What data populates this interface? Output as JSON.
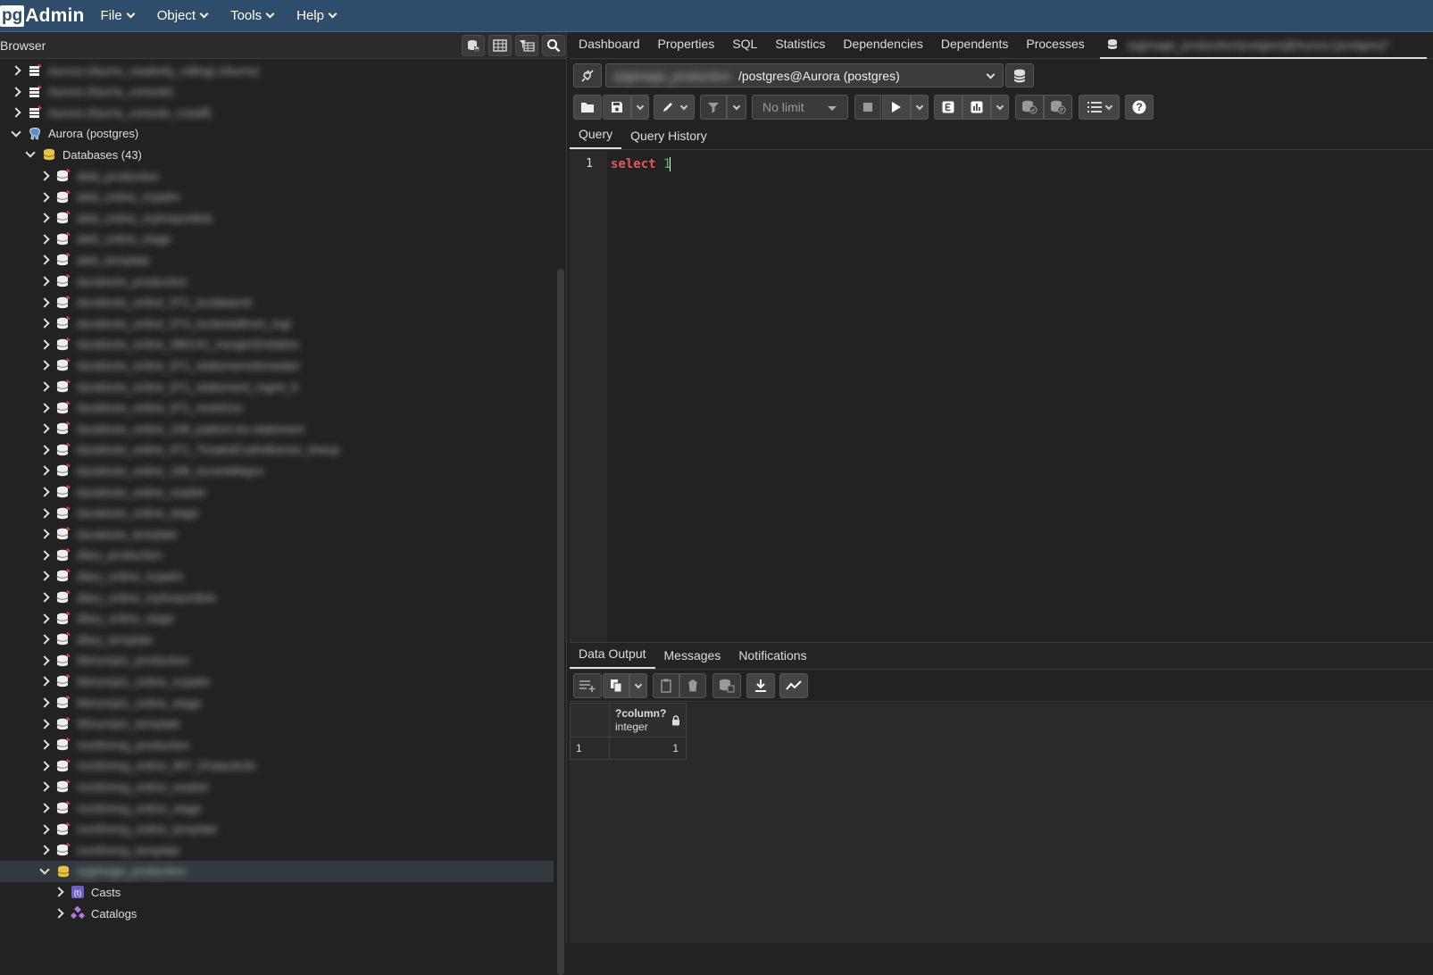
{
  "app": {
    "logo_pg": "pg",
    "logo_admin": "Admin"
  },
  "menus": [
    "File",
    "Object",
    "Tools",
    "Help"
  ],
  "browser": {
    "title": "Browser",
    "top_servers": [
      {
        "label": "Aurora (rburns_readonly_rolling) (rburns)"
      },
      {
        "label": "Aurora (rburns_console)"
      },
      {
        "label": "Aurora (rburns_console_rcstaff)"
      }
    ],
    "server": "Aurora (postgres)",
    "databases_label": "Databases (43)",
    "databases": [
      "debi_production",
      "debi_online_ncjadm",
      "debi_online_myhreportlink",
      "debi_online_stage",
      "debi_template",
      "duratiosis_production",
      "duratiosis_online_971_iscdataentr",
      "duratiosis_online_974_incitestatfront_mgr",
      "duratiosis_online_386141_mergerl2relation",
      "duratiosis_online_971_statiomemstonwater",
      "duratiosis_online_971_statioment_mgmt_fr",
      "duratiosis_online_971_moist1ns",
      "duratiosis_online_108_patient.ino.statement",
      "duratiosis_online_971_TreatedCutIndirector_lineup",
      "duratiosis_online_188_increntMapro",
      "duratiosis_online_readsit",
      "duratiosis_online_stage",
      "duratiosis_template",
      "dlary_production",
      "dlary_online_ncjadm",
      "dlary_online_myhreportlink",
      "dlary_online_stage",
      "dlary_template",
      "Winsmjsic_production",
      "Winsmjsic_online_ncjadm",
      "Winsmjsic_online_stage",
      "Winsmjsic_template",
      "morthmng_production",
      "morthmng_online_957_Dratacitclin",
      "morthmng_online_readsit",
      "morthmng_online_stage",
      "morthmng_online_template",
      "morthmng_template"
    ],
    "selected_db": "rpgimage_production",
    "children": [
      "Casts",
      "Catalogs"
    ]
  },
  "main_tabs": [
    "Dashboard",
    "Properties",
    "SQL",
    "Statistics",
    "Dependencies",
    "Dependents",
    "Processes"
  ],
  "query_tool_tab": "rpgimage_production/postgres@Aurora (postgres)*",
  "connection": {
    "db_hidden": "rpgimage_production",
    "suffix": "/postgres@Aurora (postgres)"
  },
  "toolbar": {
    "limit": "No limit"
  },
  "query_tabs": [
    "Query",
    "Query History"
  ],
  "editor": {
    "line": "1",
    "keyword": "select",
    "value": "1"
  },
  "result_tabs": [
    "Data Output",
    "Messages",
    "Notifications"
  ],
  "grid": {
    "column_name": "?column?",
    "column_type": "integer",
    "row_number": "1",
    "row_value": "1"
  }
}
